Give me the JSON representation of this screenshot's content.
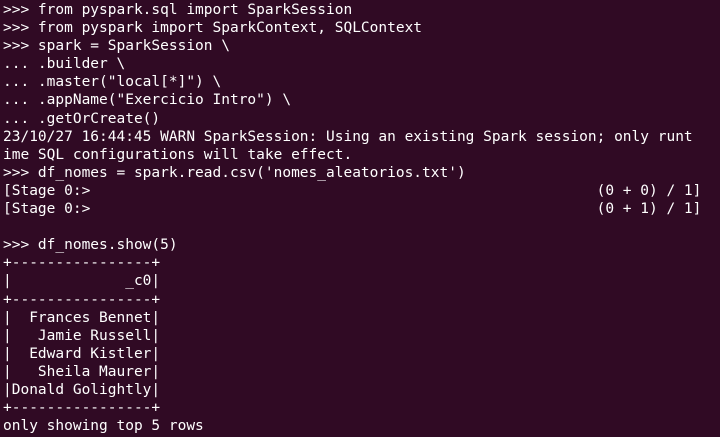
{
  "terminal": {
    "colors": {
      "background": "#300a24",
      "foreground": "#ffffff"
    },
    "lines": [
      ">>> from pyspark.sql import SparkSession",
      ">>> from pyspark import SparkContext, SQLContext",
      ">>> spark = SparkSession \\",
      "... .builder \\",
      "... .master(\"local[*]\") \\",
      "... .appName(\"Exercicio Intro\") \\",
      "... .getOrCreate()",
      "23/10/27 16:44:45 WARN SparkSession: Using an existing Spark session; only runt",
      "ime SQL configurations will take effect.",
      ">>> df_nomes = spark.read.csv('nomes_aleatorios.txt')",
      "[Stage 0:>                                                          (0 + 0) / 1]",
      "[Stage 0:>                                                          (0 + 1) / 1]",
      "",
      ">>> df_nomes.show(5)",
      "+----------------+",
      "|             _c0|",
      "+----------------+",
      "|  Frances Bennet|",
      "|   Jamie Russell|",
      "|  Edward Kistler|",
      "|   Sheila Maurer|",
      "|Donald Golightly|",
      "+----------------+",
      "only showing top 5 rows"
    ]
  }
}
